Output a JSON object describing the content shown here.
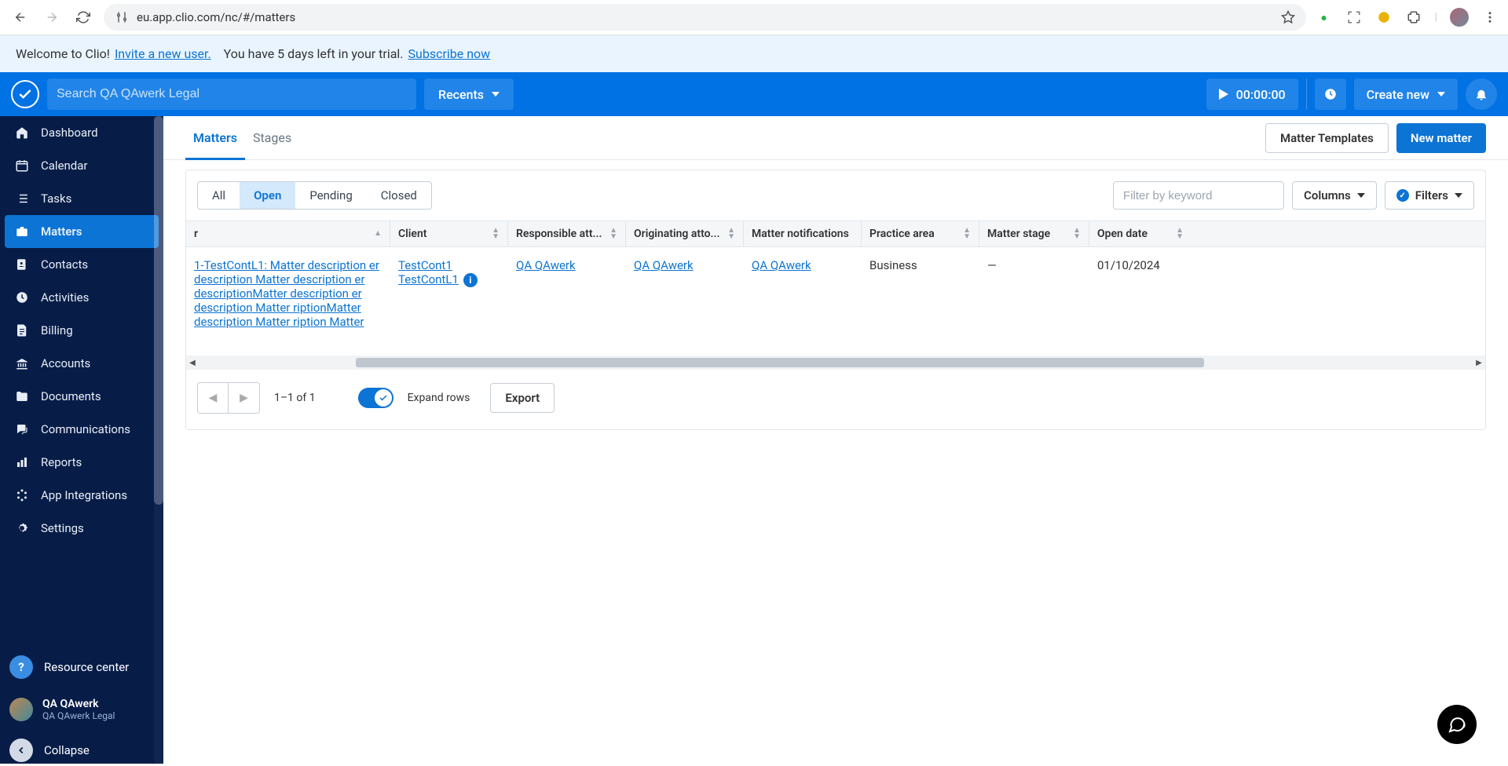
{
  "browser": {
    "url": "eu.app.clio.com/nc/#/matters"
  },
  "trial": {
    "welcome": "Welcome to Clio!",
    "invite_link": "Invite a new user.",
    "days_left": "You have 5 days left in your trial.",
    "subscribe_link": "Subscribe now"
  },
  "appbar": {
    "search_placeholder": "Search QA QAwerk Legal",
    "recents_label": "Recents",
    "timer": "00:00:00",
    "create_new": "Create new"
  },
  "sidebar": {
    "items": [
      {
        "label": "Dashboard",
        "icon": "home"
      },
      {
        "label": "Calendar",
        "icon": "calendar"
      },
      {
        "label": "Tasks",
        "icon": "list"
      },
      {
        "label": "Matters",
        "icon": "briefcase",
        "active": true
      },
      {
        "label": "Contacts",
        "icon": "contact"
      },
      {
        "label": "Activities",
        "icon": "clock"
      },
      {
        "label": "Billing",
        "icon": "doc"
      },
      {
        "label": "Accounts",
        "icon": "bank"
      },
      {
        "label": "Documents",
        "icon": "folder"
      },
      {
        "label": "Communications",
        "icon": "chat"
      },
      {
        "label": "Reports",
        "icon": "bars"
      },
      {
        "label": "App Integrations",
        "icon": "apps"
      },
      {
        "label": "Settings",
        "icon": "gear"
      }
    ],
    "resource_center": "Resource center",
    "user_name": "QA QAwerk",
    "user_firm": "QA QAwerk Legal",
    "collapse": "Collapse"
  },
  "page": {
    "tabs": [
      {
        "label": "Matters",
        "active": true
      },
      {
        "label": "Stages"
      }
    ],
    "matter_templates": "Matter Templates",
    "new_matter": "New matter"
  },
  "toolbar": {
    "segments": [
      "All",
      "Open",
      "Pending",
      "Closed"
    ],
    "active_segment": "Open",
    "filter_placeholder": "Filter by keyword",
    "columns": "Columns",
    "filters": "Filters"
  },
  "table": {
    "headers": [
      "Matter",
      "Client",
      "Responsible att...",
      "Originating atto...",
      "Matter notifications",
      "Practice area",
      "Matter stage",
      "Open date"
    ],
    "row": {
      "matter": "1-TestContL1: Matter description er description Matter description er descriptionMatter description er description Matter riptionMatter description Matter ription Matter",
      "client": "TestCont1 TestContL1",
      "responsible": "QA QAwerk",
      "originating": "QA QAwerk",
      "notifications": "QA QAwerk",
      "practice": "Business",
      "stage": "—",
      "open_date": "01/10/2024"
    }
  },
  "footer": {
    "page_info": "1–1 of 1",
    "expand_rows": "Expand rows",
    "export": "Export"
  }
}
